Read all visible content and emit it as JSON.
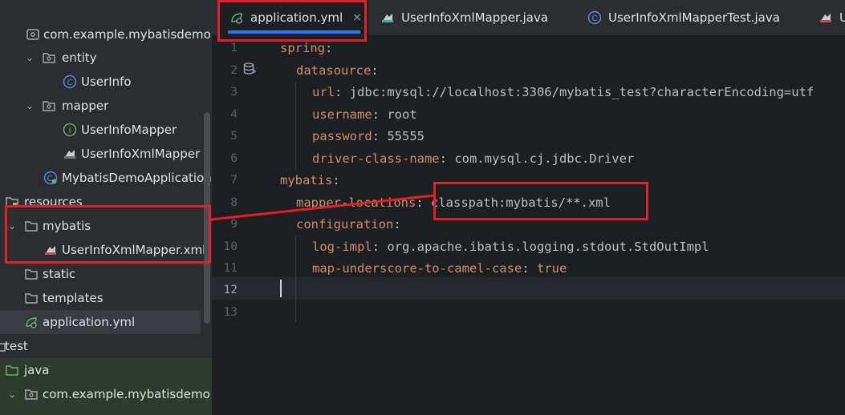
{
  "tree": {
    "items": [
      {
        "label": "com.example.mybatisdemo",
        "icon": "package-icon"
      },
      {
        "label": "entity",
        "icon": "package-icon"
      },
      {
        "label": "UserInfo",
        "icon": "class-icon"
      },
      {
        "label": "mapper",
        "icon": "package-icon"
      },
      {
        "label": "UserInfoMapper",
        "icon": "interface-icon"
      },
      {
        "label": "UserInfoXmlMapper",
        "icon": "mybatis-icon"
      },
      {
        "label": "MybatisDemoApplication",
        "icon": "spring-class-icon"
      },
      {
        "label": "resources",
        "icon": "resources-folder-icon"
      },
      {
        "label": "mybatis",
        "icon": "folder-icon"
      },
      {
        "label": "UserInfoXmlMapper.xml",
        "icon": "mybatis-xml-icon"
      },
      {
        "label": "static",
        "icon": "folder-icon"
      },
      {
        "label": "templates",
        "icon": "folder-icon"
      },
      {
        "label": "application.yml",
        "icon": "spring-yml-icon"
      },
      {
        "label": "test",
        "icon": "folder-icon"
      },
      {
        "label": "java",
        "icon": "test-folder-icon"
      },
      {
        "label": "com.example.mybatisdemo",
        "icon": "package-icon"
      }
    ]
  },
  "tabs": [
    {
      "label": "application.yml",
      "icon": "spring-yml-icon",
      "active": true,
      "close": "×"
    },
    {
      "label": "UserInfoXmlMapper.java",
      "icon": "mybatis-icon"
    },
    {
      "label": "UserInfoXmlMapperTest.java",
      "icon": "class-icon"
    },
    {
      "label": "U",
      "icon": "mybatis-icon"
    }
  ],
  "editor": {
    "line_numbers": [
      "1",
      "2",
      "3",
      "4",
      "5",
      "6",
      "7",
      "8",
      "9",
      "10",
      "11",
      "12",
      "13"
    ],
    "lines": [
      {
        "key": "spring",
        "sep": ":",
        "val": ""
      },
      {
        "key": "datasource",
        "sep": ":",
        "val": ""
      },
      {
        "key": "url",
        "sep": ":",
        "val": " jdbc:mysql://localhost:3306/mybatis_test?characterEncoding=utf"
      },
      {
        "key": "username",
        "sep": ":",
        "val": " root"
      },
      {
        "key": "password",
        "sep": ":",
        "val": " 55555"
      },
      {
        "key": "driver-class-name",
        "sep": ":",
        "val": " com.mysql.cj.jdbc.Driver"
      },
      {
        "key": "mybatis",
        "sep": ":",
        "val": ""
      },
      {
        "key": "mapper-locations",
        "sep": ":",
        "val": " classpath:mybatis/**.xml"
      },
      {
        "key": "configuration",
        "sep": ":",
        "val": ""
      },
      {
        "key": "log-impl",
        "sep": ":",
        "val": " org.apache.ibatis.logging.stdout.StdOutImpl"
      },
      {
        "key": "map-underscore-to-camel-case",
        "sep": ":",
        "val": " true"
      }
    ]
  },
  "colors": {
    "accent": "#3574f0",
    "annotation": "#e0202a",
    "yaml_key": "#cf8e6d"
  }
}
